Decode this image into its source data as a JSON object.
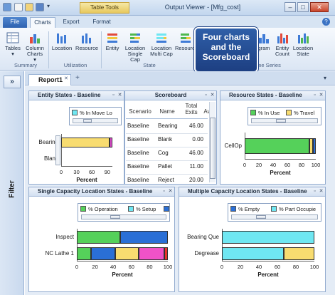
{
  "window": {
    "title": "Output Viewer - [Mfg_cost]",
    "context_tab": "Table Tools",
    "controls": [
      "–",
      "□",
      "✕"
    ]
  },
  "tabs": [
    "File",
    "Charts",
    "Export",
    "Format"
  ],
  "ribbon": {
    "buttons": [
      {
        "label": "Tables",
        "sub": "▾",
        "icon": "tables-icon"
      },
      {
        "label": "Column Charts",
        "sub": "▾",
        "icon": "column-charts-icon"
      },
      {
        "label": "Location",
        "icon": "location-icon"
      },
      {
        "label": "Resource",
        "icon": "resource-icon"
      },
      {
        "label": "Entity",
        "icon": "entity-icon"
      },
      {
        "label": "Location Single Cap",
        "icon": "location-single-cap-icon"
      },
      {
        "label": "Location Multi Cap",
        "icon": "location-multi-cap-icon"
      },
      {
        "label": "Resource",
        "icon": "resource-state-icon"
      },
      {
        "label": "gram",
        "icon": "histogram-icon"
      },
      {
        "label": "Entity Count",
        "icon": "entity-count-icon"
      },
      {
        "label": "Location State",
        "icon": "location-state-icon"
      }
    ],
    "groups": [
      "Summary",
      "Utilization",
      "State",
      "Time Series"
    ]
  },
  "callout": "Four charts and the Scoreboard",
  "side": {
    "toggle": "»",
    "label": "Filter"
  },
  "doc_tab": {
    "label": "Report1",
    "close": "✕",
    "add": "+"
  },
  "panels": {
    "entity": {
      "title": "Entity States - Baseline",
      "legend": [
        {
          "label": "% In Move Lo",
          "color": "#6fe7f2"
        }
      ],
      "xlabel": "Percent",
      "ticks": [
        "0",
        "30",
        "60",
        "90"
      ]
    },
    "scoreboard": {
      "title": "Scoreboard",
      "columns": [
        "Scenario",
        "Name",
        "Total Exits",
        "Av"
      ],
      "rows": [
        [
          "Baseline",
          "Bearing",
          "46.00"
        ],
        [
          "Baseline",
          "Blank",
          "0.00"
        ],
        [
          "Baseline",
          "Cog",
          "46.00"
        ],
        [
          "Baseline",
          "Pallet",
          "11.00"
        ],
        [
          "Baseline",
          "Reject",
          "20.00"
        ]
      ]
    },
    "resource": {
      "title": "Resource States - Baseline",
      "legend": [
        {
          "label": "% In Use",
          "color": "#55d15a"
        },
        {
          "label": "% Travel",
          "color": "#f8dc70"
        }
      ],
      "xlabel": "Percent",
      "ticks": [
        "0",
        "20",
        "40",
        "60",
        "80",
        "100"
      ]
    },
    "single": {
      "title": "Single Capacity Location States - Baseline",
      "legend": [
        {
          "label": "% Operation",
          "color": "#55d15a"
        },
        {
          "label": "% Setup",
          "color": "#6fe7f2"
        },
        {
          "label": "",
          "color": "#2a6fd6"
        }
      ],
      "xlabel": "Percent",
      "ticks": [
        "0",
        "20",
        "40",
        "60",
        "80",
        "100"
      ]
    },
    "multi": {
      "title": "Multiple Capacity Location States - Baseline",
      "legend": [
        {
          "label": "% Empty",
          "color": "#2a6fd6"
        },
        {
          "label": "% Part Occupie",
          "color": "#6fe7f2"
        }
      ],
      "xlabel": "Percent",
      "ticks": [
        "0",
        "20",
        "40",
        "60",
        "80",
        "100"
      ]
    }
  },
  "chart_data": [
    {
      "type": "bar",
      "title": "Entity States - Baseline",
      "xlabel": "Percent",
      "xlim": [
        0,
        100
      ],
      "categories": [
        "Bearing",
        "Blank"
      ],
      "series": [
        {
          "name": "% In Move Lo",
          "color": "#6fe7f2",
          "values": [
            0,
            0
          ]
        },
        {
          "name": "",
          "color": "#f8dc70",
          "values": [
            95,
            0
          ]
        },
        {
          "name": "",
          "color": "#e34bd1",
          "values": [
            5,
            0
          ]
        }
      ]
    },
    {
      "type": "bar",
      "title": "Resource States - Baseline",
      "xlabel": "Percent",
      "xlim": [
        0,
        100
      ],
      "categories": [
        "CellOp"
      ],
      "series": [
        {
          "name": "% In Use",
          "color": "#55d15a",
          "values": [
            91
          ]
        },
        {
          "name": "% Travel",
          "color": "#f8dc70",
          "values": [
            5
          ]
        },
        {
          "name": "",
          "color": "#2a6fd6",
          "values": [
            4
          ]
        }
      ]
    },
    {
      "type": "bar",
      "title": "Single Capacity Location States - Baseline",
      "xlabel": "Percent",
      "xlim": [
        0,
        100
      ],
      "categories": [
        "Inspect",
        "NC Lathe 1"
      ],
      "series": [
        {
          "name": "% Operation",
          "color": "#55d15a",
          "values": [
            48,
            16
          ]
        },
        {
          "name": "% Setup",
          "color": "#6fe7f2",
          "values": [
            0,
            0
          ]
        },
        {
          "name": "",
          "color": "#2a6fd6",
          "values": [
            52,
            26
          ]
        },
        {
          "name": "",
          "color": "#f8dc70",
          "values": [
            0,
            26
          ]
        },
        {
          "name": "",
          "color": "#f052c8",
          "values": [
            0,
            28
          ]
        },
        {
          "name": "",
          "color": "#e8342c",
          "values": [
            0,
            4
          ]
        }
      ]
    },
    {
      "type": "bar",
      "title": "Multiple Capacity Location States - Baseline",
      "xlabel": "Percent",
      "xlim": [
        0,
        100
      ],
      "categories": [
        "Bearing Que",
        "Degrease"
      ],
      "series": [
        {
          "name": "% Empty",
          "color": "#2a6fd6",
          "values": [
            0,
            0
          ]
        },
        {
          "name": "% Part Occupie",
          "color": "#6fe7f2",
          "values": [
            100,
            67
          ]
        },
        {
          "name": "",
          "color": "#f8dc70",
          "values": [
            0,
            33
          ]
        }
      ]
    }
  ]
}
